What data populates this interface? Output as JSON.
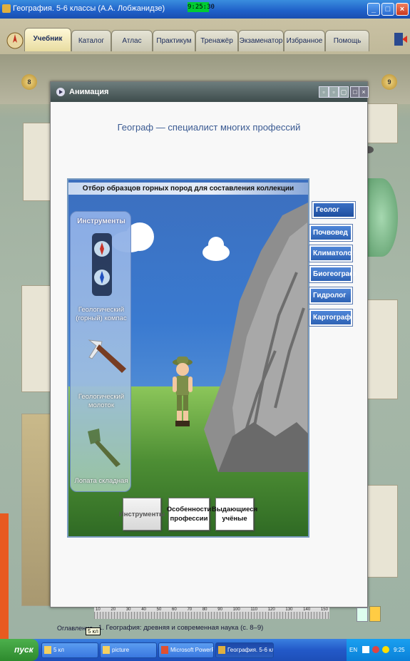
{
  "window": {
    "title": "География. 5-6 классы (А.А. Лобжанидзе)",
    "clock_top": "9:25:30",
    "buttons": [
      "_",
      "□",
      "×"
    ]
  },
  "menu": {
    "tabs": [
      "Учебник",
      "Каталог",
      "Атлас",
      "Практикум",
      "Тренажёр",
      "Экзаменатор",
      "Избранное",
      "Помощь"
    ],
    "active": "Учебник"
  },
  "page": {
    "badge_left": "8",
    "badge_right": "9",
    "chapter_title": "1. География: древняя и современная наука (с. 8–9)",
    "contents_label": "Оглавление",
    "tooltip": "5 кл",
    "ruler_ticks": [
      "10",
      "20",
      "30",
      "40",
      "50",
      "60",
      "70",
      "80",
      "90",
      "100",
      "110",
      "120",
      "130",
      "140",
      "150"
    ]
  },
  "dialog": {
    "title": "Анимация",
    "headline": "Географ — специалист многих профессий",
    "stage_title": "Отбор образцов горных пород для составления коллекции",
    "tools_header": "Инструменты",
    "tools": [
      {
        "label": "Геологический (горный) компас",
        "icon": "compass-icon"
      },
      {
        "label": "Геологический молоток",
        "icon": "hammer-icon"
      },
      {
        "label": "Лопата складная",
        "icon": "shovel-icon"
      }
    ],
    "bottom_buttons": [
      {
        "label": "Инструменты",
        "active": true
      },
      {
        "label": "Особенности профессии",
        "active": false
      },
      {
        "label": "Выдающиеся учёные",
        "active": false
      }
    ],
    "professions": [
      {
        "label": "Геолог",
        "active": true
      },
      {
        "label": "Почвовед",
        "active": false
      },
      {
        "label": "Климатолог",
        "active": false
      },
      {
        "label": "Биогеограф",
        "active": false
      },
      {
        "label": "Гидролог",
        "active": false
      },
      {
        "label": "Картограф",
        "active": false
      }
    ]
  },
  "taskbar": {
    "start": "пуск",
    "items": [
      {
        "label": "5 кл",
        "active": false
      },
      {
        "label": "picture",
        "active": false
      },
      {
        "label": "Microsoft PowerPoint ...",
        "active": false
      },
      {
        "label": "География. 5-6 клас...",
        "active": true
      }
    ],
    "tray_lang": "EN",
    "tray_time": "9:25"
  },
  "colors": {
    "titlebar": "#1f5fc8",
    "profession_button": "#2d62b4",
    "headline": "#3a5a92",
    "sky": "#3a7ad0",
    "grass": "#56963a"
  }
}
